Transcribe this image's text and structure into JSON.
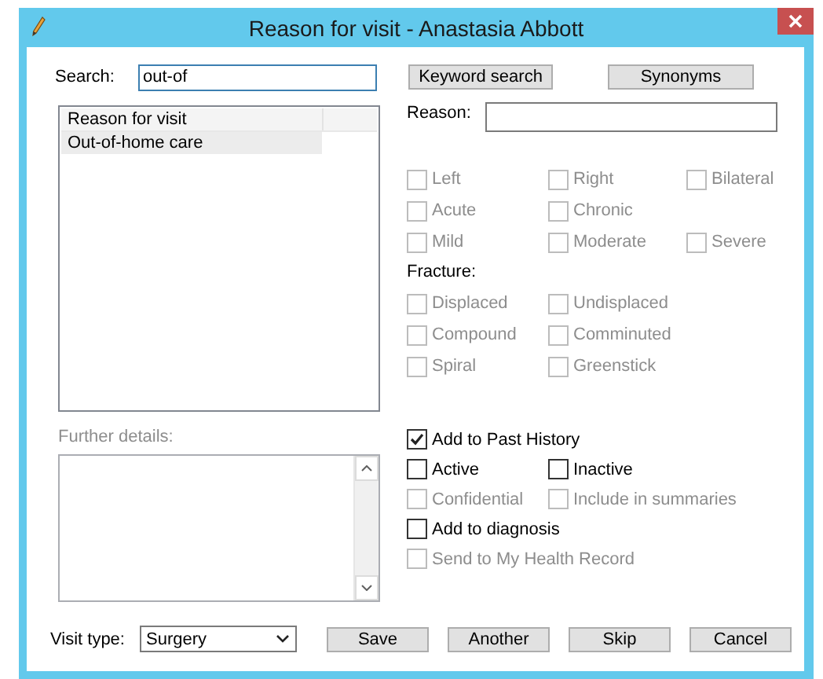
{
  "window": {
    "title": "Reason for visit - Anastasia Abbott"
  },
  "search": {
    "label": "Search:",
    "value": "out-of"
  },
  "top_buttons": [
    "Keyword search",
    "Synonyms"
  ],
  "results": {
    "header": "Reason for visit",
    "items": [
      {
        "label": "Out-of-home care",
        "selected": true
      }
    ]
  },
  "reason": {
    "label": "Reason:"
  },
  "qualifiers": [
    [
      {
        "label": "Left",
        "checked": false,
        "disabled": true
      },
      {
        "label": "Right",
        "checked": false,
        "disabled": true
      },
      {
        "label": "Bilateral",
        "checked": false,
        "disabled": true
      }
    ],
    [
      {
        "label": "Acute",
        "checked": false,
        "disabled": true
      },
      {
        "label": "Chronic",
        "checked": false,
        "disabled": true
      }
    ],
    [
      {
        "label": "Mild",
        "checked": false,
        "disabled": true
      },
      {
        "label": "Moderate",
        "checked": false,
        "disabled": true
      },
      {
        "label": "Severe",
        "checked": false,
        "disabled": true
      }
    ]
  ],
  "fracture": {
    "label": "Fracture:",
    "rows": [
      [
        {
          "label": "Displaced",
          "checked": false,
          "disabled": true
        },
        {
          "label": "Undisplaced",
          "checked": false,
          "disabled": true
        }
      ],
      [
        {
          "label": "Compound",
          "checked": false,
          "disabled": true
        },
        {
          "label": "Comminuted",
          "checked": false,
          "disabled": true
        }
      ],
      [
        {
          "label": "Spiral",
          "checked": false,
          "disabled": true
        },
        {
          "label": "Greenstick",
          "checked": false,
          "disabled": true
        }
      ]
    ]
  },
  "further_details": {
    "label": "Further details:",
    "disabled": true
  },
  "history": [
    [
      {
        "label": "Add to Past History",
        "checked": true,
        "disabled": false
      }
    ],
    [
      {
        "label": "Active",
        "checked": false,
        "disabled": false
      },
      {
        "label": "Inactive",
        "checked": false,
        "disabled": false
      }
    ],
    [
      {
        "label": "Confidential",
        "checked": false,
        "disabled": true
      },
      {
        "label": "Include in summaries",
        "checked": false,
        "disabled": true
      }
    ],
    [
      {
        "label": "Add to diagnosis",
        "checked": false,
        "disabled": false
      }
    ],
    [
      {
        "label": "Send to My Health Record",
        "checked": false,
        "disabled": true
      }
    ]
  ],
  "visit_type": {
    "label": "Visit type:",
    "value": "Surgery"
  },
  "actions": [
    "Save",
    "Another",
    "Skip",
    "Cancel"
  ]
}
